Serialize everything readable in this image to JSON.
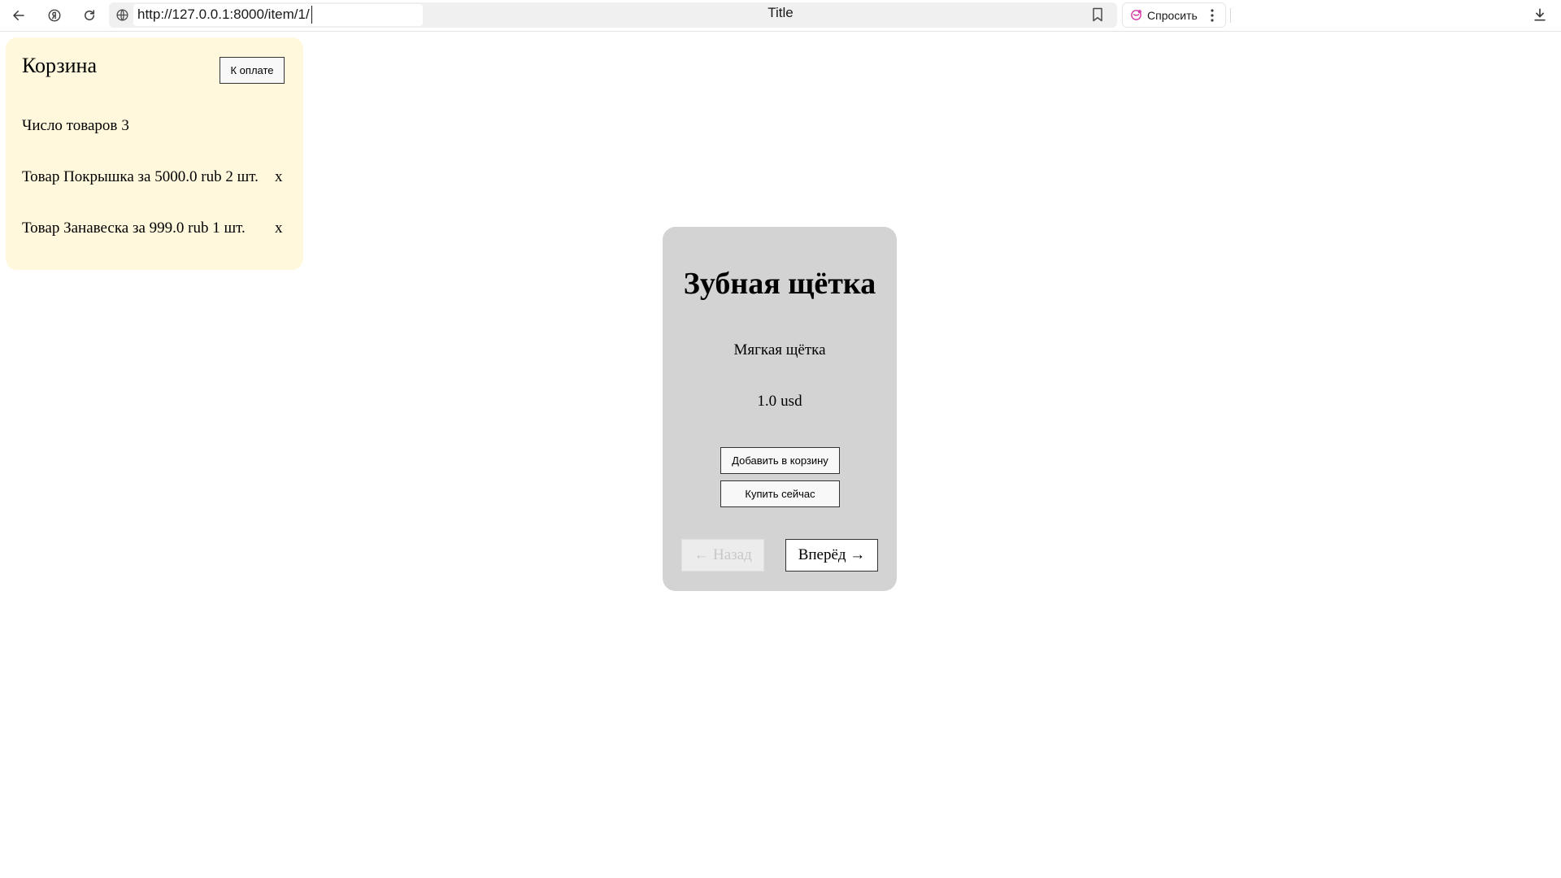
{
  "browser": {
    "url": "http://127.0.0.1:8000/item/1/",
    "page_title": "Title",
    "ask_label": "Спросить",
    "icons": {
      "back": "arrow-left-icon",
      "yandex": "yandex-icon",
      "reload": "reload-icon",
      "site_info": "globe-icon",
      "bookmark": "bookmark-icon",
      "ask": "alice-icon",
      "menu": "kebab-menu-icon",
      "download": "download-icon"
    }
  },
  "cart": {
    "title": "Корзина",
    "checkout_label": "К оплате",
    "count_label": "Число товаров",
    "count_value": "3",
    "items": [
      {
        "text": "Товар Покрышка за 5000.0 rub 2 шт.",
        "remove_label": "x"
      },
      {
        "text": "Товар Занавеска за 999.0 rub 1 шт.",
        "remove_label": "x"
      }
    ],
    "background_color": "#fff8dc"
  },
  "product": {
    "name": "Зубная щётка",
    "description": "Мягкая щётка",
    "price_value": "1.0",
    "price_currency": "usd",
    "add_to_cart_label": "Добавить в корзину",
    "buy_now_label": "Купить сейчас",
    "back_label": "← Назад",
    "next_label": "Вперёд →",
    "back_disabled": true,
    "card_color": "#d3d3d3"
  }
}
